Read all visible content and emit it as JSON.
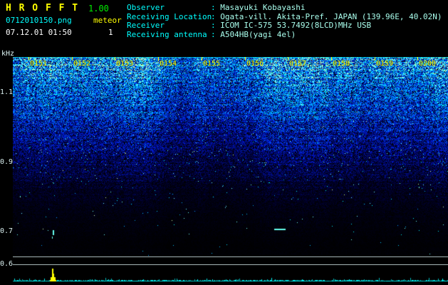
{
  "header": {
    "app_title": "H R O F F T",
    "version": "1.00",
    "filename": "0712010150.png",
    "mode": "meteor",
    "count": "1",
    "datetime": "07.12.01 01:50",
    "sep": ":",
    "info": [
      {
        "label": "Observer",
        "value": "Masayuki Kobayashi"
      },
      {
        "label": "Receiving Location",
        "value": "Ogata-vill. Akita-Pref. JAPAN (139.96E, 40.02N)"
      },
      {
        "label": "Receiver",
        "value": "ICOM IC-575 53.7492(8LCD)MHz USB"
      },
      {
        "label": "Receiving antenna",
        "value": "A504HB(yagi 4el)"
      }
    ]
  },
  "spectrogram": {
    "unit": "kHz",
    "freq_labels": [
      "1.1",
      "0.9",
      "0.7",
      "0.6"
    ],
    "time_labels": [
      "0151",
      "0152",
      "0153",
      "0154",
      "0155",
      "0156",
      "0157",
      "0158",
      "0159",
      "0200"
    ]
  },
  "chart_data": {
    "type": "heatmap",
    "title": "",
    "x_tick_labels": [
      "0151",
      "0152",
      "0153",
      "0154",
      "0155",
      "0156",
      "0157",
      "0158",
      "0159",
      "0200"
    ],
    "y_axis_label": "kHz",
    "y_tick_labels": [
      "1.1",
      "0.9",
      "0.7",
      "0.6"
    ],
    "y_range_khz": [
      0.6,
      1.2
    ],
    "content": "radio noise spectrogram; intensity fades from dense bright blue/cyan noise near 1.2 kHz to black near 0.6 kHz",
    "activity_graph": {
      "baseline": "flat cyan noise trace",
      "spike_time": "0151",
      "spike_color": "#ffff00"
    }
  },
  "colors": {
    "background": "#000000",
    "accent_yellow": "#ffff00",
    "accent_cyan": "#00ffff",
    "accent_green": "#00ee00",
    "noise_blue": "#0040ff"
  }
}
